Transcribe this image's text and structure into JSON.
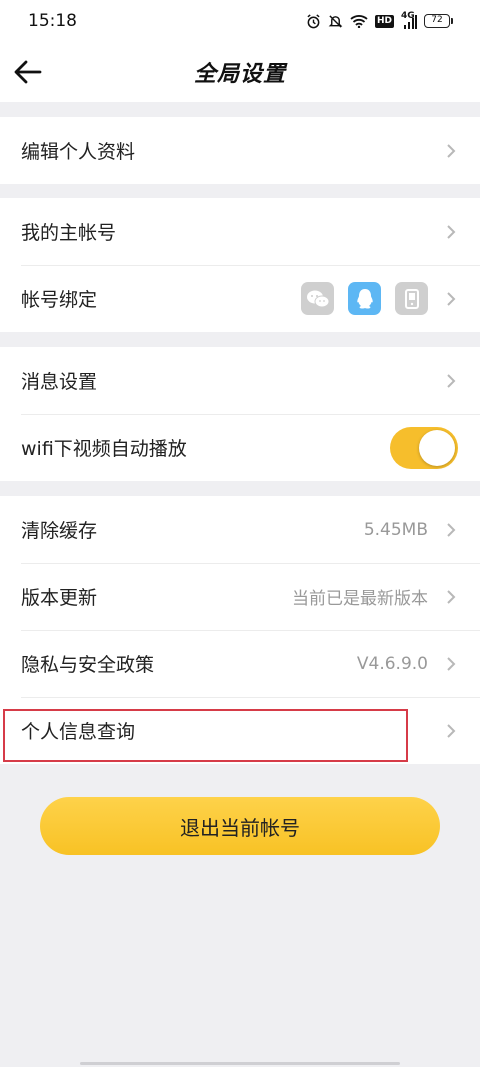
{
  "status_bar": {
    "time": "15:18",
    "hd_label": "HD",
    "network_label": "4G",
    "battery_level": "72"
  },
  "header": {
    "title": "全局设置"
  },
  "sections": {
    "profile": {
      "edit_profile": "编辑个人资料"
    },
    "account": {
      "main_account": "我的主帐号",
      "account_binding": "帐号绑定",
      "binding_icons": [
        "wechat-icon",
        "qq-icon",
        "phone-icon"
      ]
    },
    "notifications": {
      "message_settings": "消息设置",
      "wifi_autoplay": "wifi下视频自动播放",
      "wifi_autoplay_on": true
    },
    "system": {
      "clear_cache": "清除缓存",
      "cache_size": "5.45MB",
      "version_update": "版本更新",
      "version_status": "当前已是最新版本",
      "privacy_policy": "隐私与安全政策",
      "app_version": "V4.6.9.0",
      "personal_info_query": "个人信息查询"
    }
  },
  "logout_button": "退出当前帐号",
  "colors": {
    "accent": "#f8c225",
    "highlight_border": "#d63b48",
    "background": "#efeff2"
  }
}
